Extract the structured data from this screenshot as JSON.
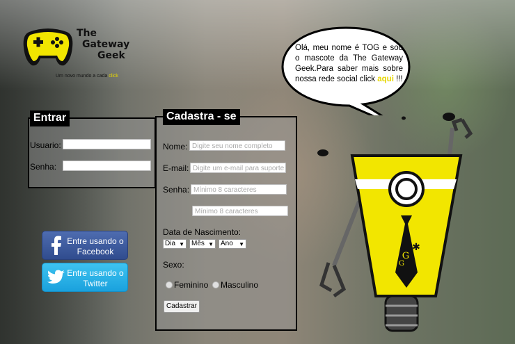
{
  "logo": {
    "line1": "The",
    "line2": "Gateway",
    "line3": "Geek",
    "tagline": "Um novo mundo a cada",
    "tagline_click": "click"
  },
  "login": {
    "title": "Entrar",
    "user_label": "Usuario:",
    "user_value": "",
    "pass_label": "Senha:",
    "pass_value": ""
  },
  "social": {
    "facebook": "Entre usando o Facebook",
    "twitter": "Entre usando o Twitter"
  },
  "register": {
    "title": "Cadastra - se",
    "name_label": "Nome:",
    "name_placeholder": "Digite seu nome completo",
    "email_label": "E-mail:",
    "email_placeholder": "Digite um e-mail para suporte",
    "pass_label": "Senha:",
    "pass_placeholder": "Mínimo 8 caracteres",
    "pass_confirm_placeholder": "Mínimo 8 caracteres",
    "birth_label": "Data de Nascimento:",
    "day": "Dia",
    "month": "Mês",
    "year": "Ano",
    "sex_label": "Sexo:",
    "female": "Feminino",
    "male": "Masculino",
    "submit": "Cadastrar"
  },
  "mascot": {
    "speech": "Olá, meu nome é TOG e sou o mascote da The Gateway Geek.Para saber mais sobre nossa rede social click",
    "link": "aqui",
    "suffix": "!!!"
  },
  "colors": {
    "accent_yellow": "#f2e600",
    "facebook_blue": "#3b5998",
    "twitter_blue": "#29b3ea"
  }
}
